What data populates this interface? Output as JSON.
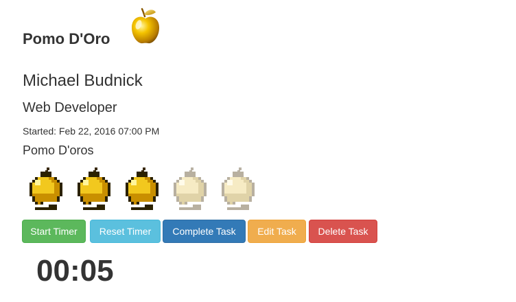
{
  "header": {
    "title": "Pomo D'Oro",
    "logo_icon": "golden-apple-icon"
  },
  "profile": {
    "name": "Michael Budnick",
    "role": "Web Developer",
    "started": "Started: Feb 22, 2016 07:00 PM"
  },
  "pomodoros": {
    "label": "Pomo D'oros",
    "completed": 3,
    "total": 5,
    "colors": {
      "filled": "#f2c81e",
      "empty": "#f6ebc4"
    }
  },
  "buttons": {
    "start": "Start Timer",
    "reset": "Reset Timer",
    "complete": "Complete Task",
    "edit": "Edit Task",
    "delete": "Delete Task"
  },
  "timer": {
    "display": "00:05"
  },
  "colors": {
    "success": "#5cb85c",
    "info": "#5bc0de",
    "primary": "#337ab7",
    "warning": "#f0ad4e",
    "danger": "#d9534f"
  }
}
